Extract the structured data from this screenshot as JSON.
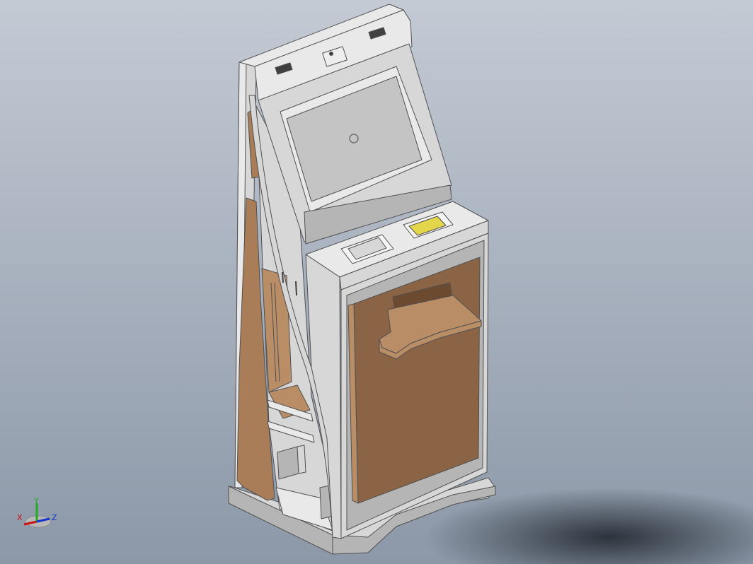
{
  "viewport": {
    "background_top": "#c3cad4",
    "background_bottom": "#8c98a8"
  },
  "colors": {
    "shell": "#d7d7d7",
    "shell_dark": "#b5b5b5",
    "shell_light": "#e9e9e9",
    "wood": "#8a6444",
    "wood_light": "#b98d66",
    "wood_side": "#a97d57",
    "screen": "#c4c4c4",
    "card_reader": "#e3d64a",
    "outline": "#505050"
  },
  "triad": {
    "x_label": "X",
    "y_label": "Y",
    "z_label": "Z",
    "x_color": "#cc1111",
    "y_color": "#22aa22",
    "z_color": "#1133cc"
  }
}
